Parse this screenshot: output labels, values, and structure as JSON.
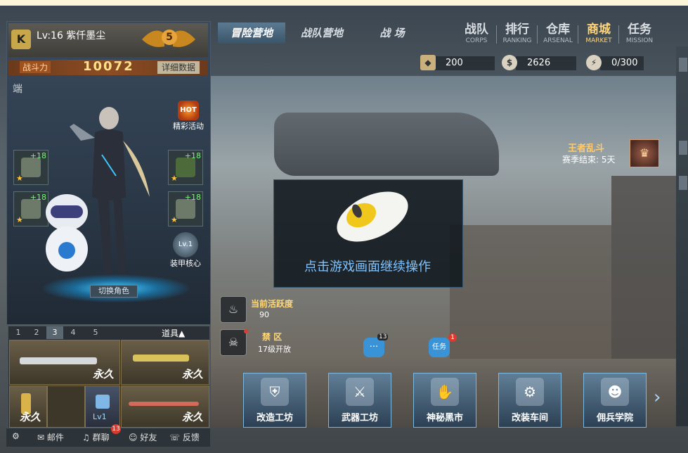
{
  "player": {
    "level_name": "Lv:16 紫仟墨尘",
    "rank_number": "5",
    "power_label": "战斗力",
    "power_value": "10072",
    "detail_button": "详细数据",
    "client_tag": "端"
  },
  "hot_activity": {
    "icon_text": "HOT",
    "label": "精彩活动"
  },
  "equipment": [
    {
      "plus": "+18",
      "star": "★"
    },
    {
      "plus": "+18",
      "star": "★"
    },
    {
      "plus": "+18",
      "star": "★"
    },
    {
      "plus": "+18",
      "star": "★"
    }
  ],
  "armor_core": {
    "level": "Lv.1",
    "label": "装甲核心"
  },
  "switch_role": "切换角色",
  "weapon_tabs": [
    "1",
    "2",
    "3",
    "4",
    "5"
  ],
  "weapon_tab_active": "3",
  "items_button": "道具▲",
  "weapons": [
    {
      "label": "永久"
    },
    {
      "label": "永久"
    },
    {
      "label": "永久"
    },
    {
      "label": "Lv1"
    },
    {
      "label": "永久"
    }
  ],
  "bottom_bar": {
    "mail": "邮件",
    "group_chat": "群聊",
    "group_badge": "13",
    "friends": "好友",
    "feedback": "反馈"
  },
  "top_tabs": [
    "冒险营地",
    "战队营地",
    "战 场"
  ],
  "menu": [
    {
      "cn": "战队",
      "en": "CORPS"
    },
    {
      "cn": "排行",
      "en": "RANKING"
    },
    {
      "cn": "仓库",
      "en": "ARSENAL"
    },
    {
      "cn": "商城",
      "en": "MARKET"
    },
    {
      "cn": "任务",
      "en": "MISSION"
    }
  ],
  "resources": {
    "crystal": "200",
    "coins": "2626",
    "energy": "0/300",
    "coin_icon": "$",
    "energy_icon": "⚡"
  },
  "king_fight": {
    "title": "王者乱斗",
    "season": "赛季结束: 5天"
  },
  "overlay": {
    "text": "点击游戏画面继续操作"
  },
  "activity": {
    "current_title": "当前活跃度",
    "current_value": "90",
    "forbidden_title": "禁 区",
    "forbidden_sub": "17级开放"
  },
  "chat_bubble": {
    "badge": "13"
  },
  "task_bubble": {
    "label": "任务",
    "badge": "1"
  },
  "functions": [
    "改造工坊",
    "武器工坊",
    "神秘黑市",
    "改装车间",
    "佣兵学院"
  ],
  "colors": {
    "accent_gold": "#ffd67a",
    "overlay_text": "#7fc3ff",
    "badge_red": "#e0392c"
  }
}
